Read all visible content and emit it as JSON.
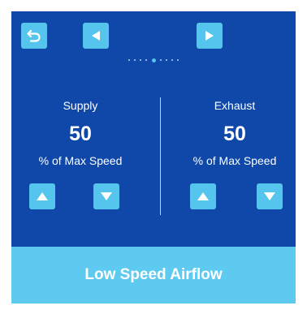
{
  "supply": {
    "label": "Supply",
    "value": "50",
    "unit": "% of Max Speed"
  },
  "exhaust": {
    "label": "Exhaust",
    "value": "50",
    "unit": "% of Max Speed"
  },
  "pager": {
    "dot_count": 9,
    "active_index": 4
  },
  "footer": {
    "label": "Low Speed Airflow"
  },
  "colors": {
    "panel_bg": "#0f48a8",
    "button": "#55c5ee",
    "footer_bg": "#5fcaf0",
    "text": "#ffffff"
  },
  "icons": {
    "back": "back-arrow-icon",
    "prev": "triangle-left-icon",
    "next": "triangle-right-icon",
    "up": "triangle-up-icon",
    "down": "triangle-down-icon"
  }
}
